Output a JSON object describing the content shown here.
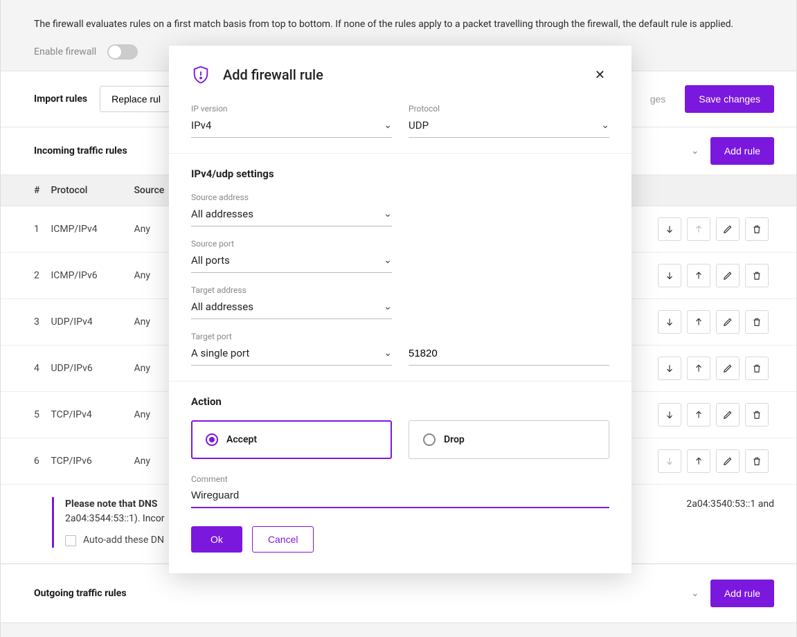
{
  "intro_text": "The firewall evaluates rules on a first match basis from top to bottom. If none of the rules apply to a packet travelling through the firewall, the default rule is applied.",
  "enable_firewall_label": "Enable firewall",
  "import": {
    "title": "Import rules",
    "replace_button": "Replace rul",
    "discard_button": "ges",
    "save_button": "Save changes"
  },
  "incoming": {
    "title": "Incoming traffic rules",
    "add_button": "Add rule",
    "columns": {
      "num": "#",
      "protocol": "Protocol",
      "source": "Source"
    },
    "rows": [
      {
        "num": "1",
        "protocol": "ICMP/IPv4",
        "source": "Any",
        "up_disabled": true,
        "down_disabled": false
      },
      {
        "num": "2",
        "protocol": "ICMP/IPv6",
        "source": "Any",
        "up_disabled": false,
        "down_disabled": false
      },
      {
        "num": "3",
        "protocol": "UDP/IPv4",
        "source": "Any",
        "up_disabled": false,
        "down_disabled": false
      },
      {
        "num": "4",
        "protocol": "UDP/IPv6",
        "source": "Any",
        "up_disabled": false,
        "down_disabled": false
      },
      {
        "num": "5",
        "protocol": "TCP/IPv4",
        "source": "Any",
        "up_disabled": false,
        "down_disabled": false
      },
      {
        "num": "6",
        "protocol": "TCP/IPv6",
        "source": "Any",
        "up_disabled": false,
        "down_disabled": true
      }
    ],
    "note_prefix": "Please note that DNS",
    "note_mid": "2a04:3540:53::1 and",
    "note_suffix": "2a04:3544:53::1). Incor",
    "auto_add_label": "Auto-add these DN"
  },
  "outgoing": {
    "title": "Outgoing traffic rules",
    "add_button": "Add rule"
  },
  "modal": {
    "title": "Add firewall rule",
    "ip_version": {
      "label": "IP version",
      "value": "IPv4"
    },
    "protocol": {
      "label": "Protocol",
      "value": "UDP"
    },
    "settings_heading": "IPv4/udp settings",
    "source_address": {
      "label": "Source address",
      "value": "All addresses"
    },
    "source_port": {
      "label": "Source port",
      "value": "All ports"
    },
    "target_address": {
      "label": "Target address",
      "value": "All addresses"
    },
    "target_port": {
      "label": "Target port",
      "value": "A single port",
      "port_value": "51820"
    },
    "action_heading": "Action",
    "action_accept": "Accept",
    "action_drop": "Drop",
    "action_selected": "accept",
    "comment": {
      "label": "Comment",
      "value": "Wireguard"
    },
    "ok": "Ok",
    "cancel": "Cancel"
  }
}
